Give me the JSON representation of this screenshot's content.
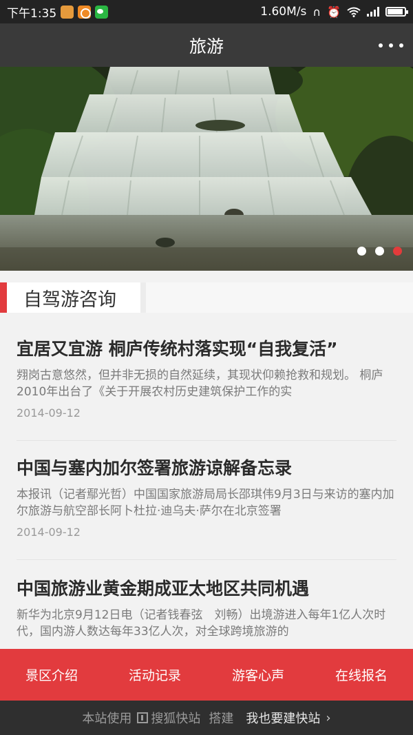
{
  "status_bar": {
    "time": "下午1:35",
    "network_speed": "1.60M/s",
    "battery_level": 0.9,
    "icons": [
      "app-orange-icon",
      "qq-music-icon",
      "wechat-icon",
      "headset-icon",
      "alarm-icon",
      "wifi-icon",
      "signal-icon",
      "battery-icon"
    ]
  },
  "header": {
    "title": "旅游"
  },
  "banner": {
    "slide_count": 3,
    "active_slide": 3
  },
  "section": {
    "title": "自驾游咨询"
  },
  "articles": [
    {
      "title": "宜居又宜游 桐庐传统村落实现“自我复活”",
      "summary": "翙岗古意悠然，但并非无损的自然延续，其现状仰赖抢救和规划。 桐庐2010年出台了《关于开展农村历史建筑保护工作的实",
      "date": "2014-09-12"
    },
    {
      "title": "中国与塞内加尔签署旅游谅解备忘录",
      "summary": "本报讯（记者鄢光哲）中国国家旅游局局长邵琪伟9月3日与来访的塞内加尔旅游与航空部长阿卜杜拉·迪乌夫·萨尔在北京签署",
      "date": "2014-09-12"
    },
    {
      "title": "中国旅游业黄金期成亚太地区共同机遇",
      "summary": "新华为北京9月12日电（记者钱春弦　刘畅）出境游进入每年1亿人次时代，国内游人数达每年33亿人次，对全球跨境旅游的",
      "date": ""
    }
  ],
  "bottom_nav": {
    "items": [
      "景区介绍",
      "活动记录",
      "游客心声",
      "在线报名"
    ]
  },
  "footer": {
    "prefix": "本站使用",
    "brand": "搜狐快站",
    "suffix": "搭建",
    "cta": "我也要建快站",
    "chevron": "›"
  },
  "colors": {
    "accent": "#e23b3e",
    "title_bar": "#3a3a3a",
    "status_bar": "#232323"
  }
}
